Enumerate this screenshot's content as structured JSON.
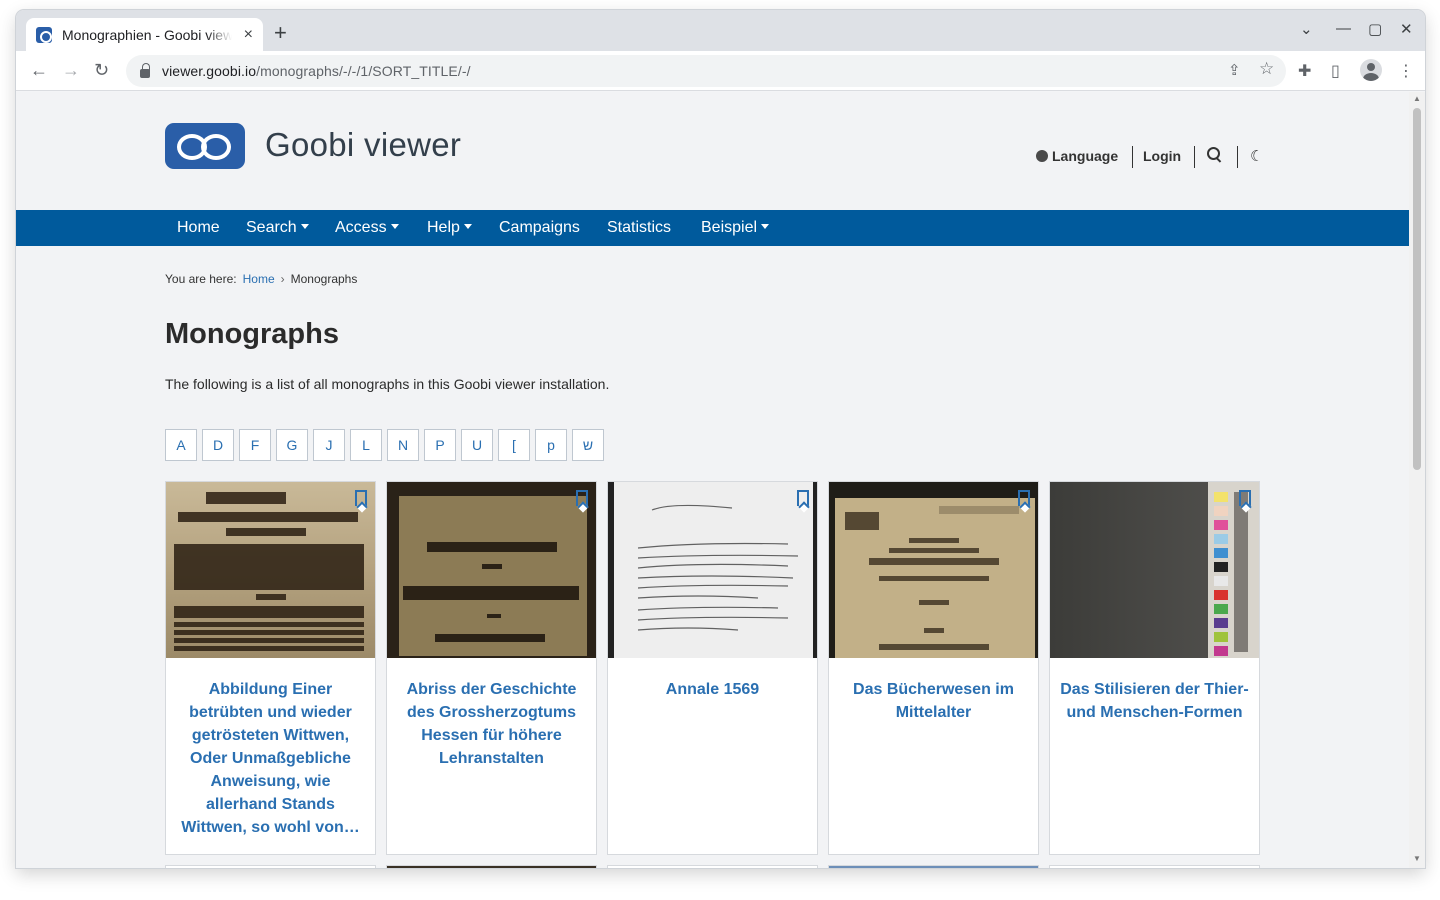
{
  "browser": {
    "tab_title": "Monographien - Goobi viewer",
    "close_glyph": "×",
    "newtab_glyph": "+",
    "url_host": "viewer.goobi.io",
    "url_path": "/monographs/-/-/1/SORT_TITLE/-/",
    "back_glyph": "←",
    "forward_glyph": "→",
    "reload_glyph": "↻",
    "share_glyph": "⇪",
    "star_glyph": "☆",
    "extensions_glyph": "✚",
    "sidepanel_glyph": "▯",
    "menu_glyph": "⋮",
    "win_dropdown": "⌄",
    "win_minimize": "—",
    "win_maximize": "▢",
    "win_close": "✕"
  },
  "site": {
    "title": "Goobi viewer",
    "language_label": "Language",
    "login_label": "Login",
    "moon_glyph": "☾"
  },
  "nav": {
    "items": [
      {
        "label": "Home",
        "dropdown": false
      },
      {
        "label": "Search",
        "dropdown": true
      },
      {
        "label": "Access",
        "dropdown": true
      },
      {
        "label": "Help",
        "dropdown": true
      },
      {
        "label": "Campaigns",
        "dropdown": false
      },
      {
        "label": "Statistics",
        "dropdown": false
      },
      {
        "label": "Beispiel",
        "dropdown": true
      }
    ]
  },
  "breadcrumb": {
    "prefix": "You are here:",
    "home": "Home",
    "separator": "›",
    "current": "Monographs"
  },
  "page": {
    "heading": "Monographs",
    "intro": "The following is a list of all monographs in this Goobi viewer installation."
  },
  "letters": [
    "A",
    "D",
    "F",
    "G",
    "J",
    "L",
    "N",
    "P",
    "U",
    "[",
    "p",
    "ש"
  ],
  "cards": [
    {
      "title": "Abbildung Einer betrübten und wieder getrösteten Wittwen, Oder Unmaßgebliche Anweisung, wie allerhand Stands Wittwen, so wohl von…",
      "thumb_color": "#b9a98b"
    },
    {
      "title": "Abriss der Geschichte des Grossherzogtums Hessen für höhere Lehranstalten",
      "thumb_color": "#7a6a48"
    },
    {
      "title": "Annale 1569",
      "thumb_color": "#e6e6e6"
    },
    {
      "title": "Das Bücherwesen im Mittelalter",
      "thumb_color": "#bfae84"
    },
    {
      "title": "Das Stilisieren der Thier- und Menschen-Formen",
      "thumb_color": "#4a4a47"
    }
  ],
  "colors": {
    "brand_blue": "#005a9c",
    "link_blue": "#2a6fb1",
    "logo_blue": "#2a5ea8"
  }
}
